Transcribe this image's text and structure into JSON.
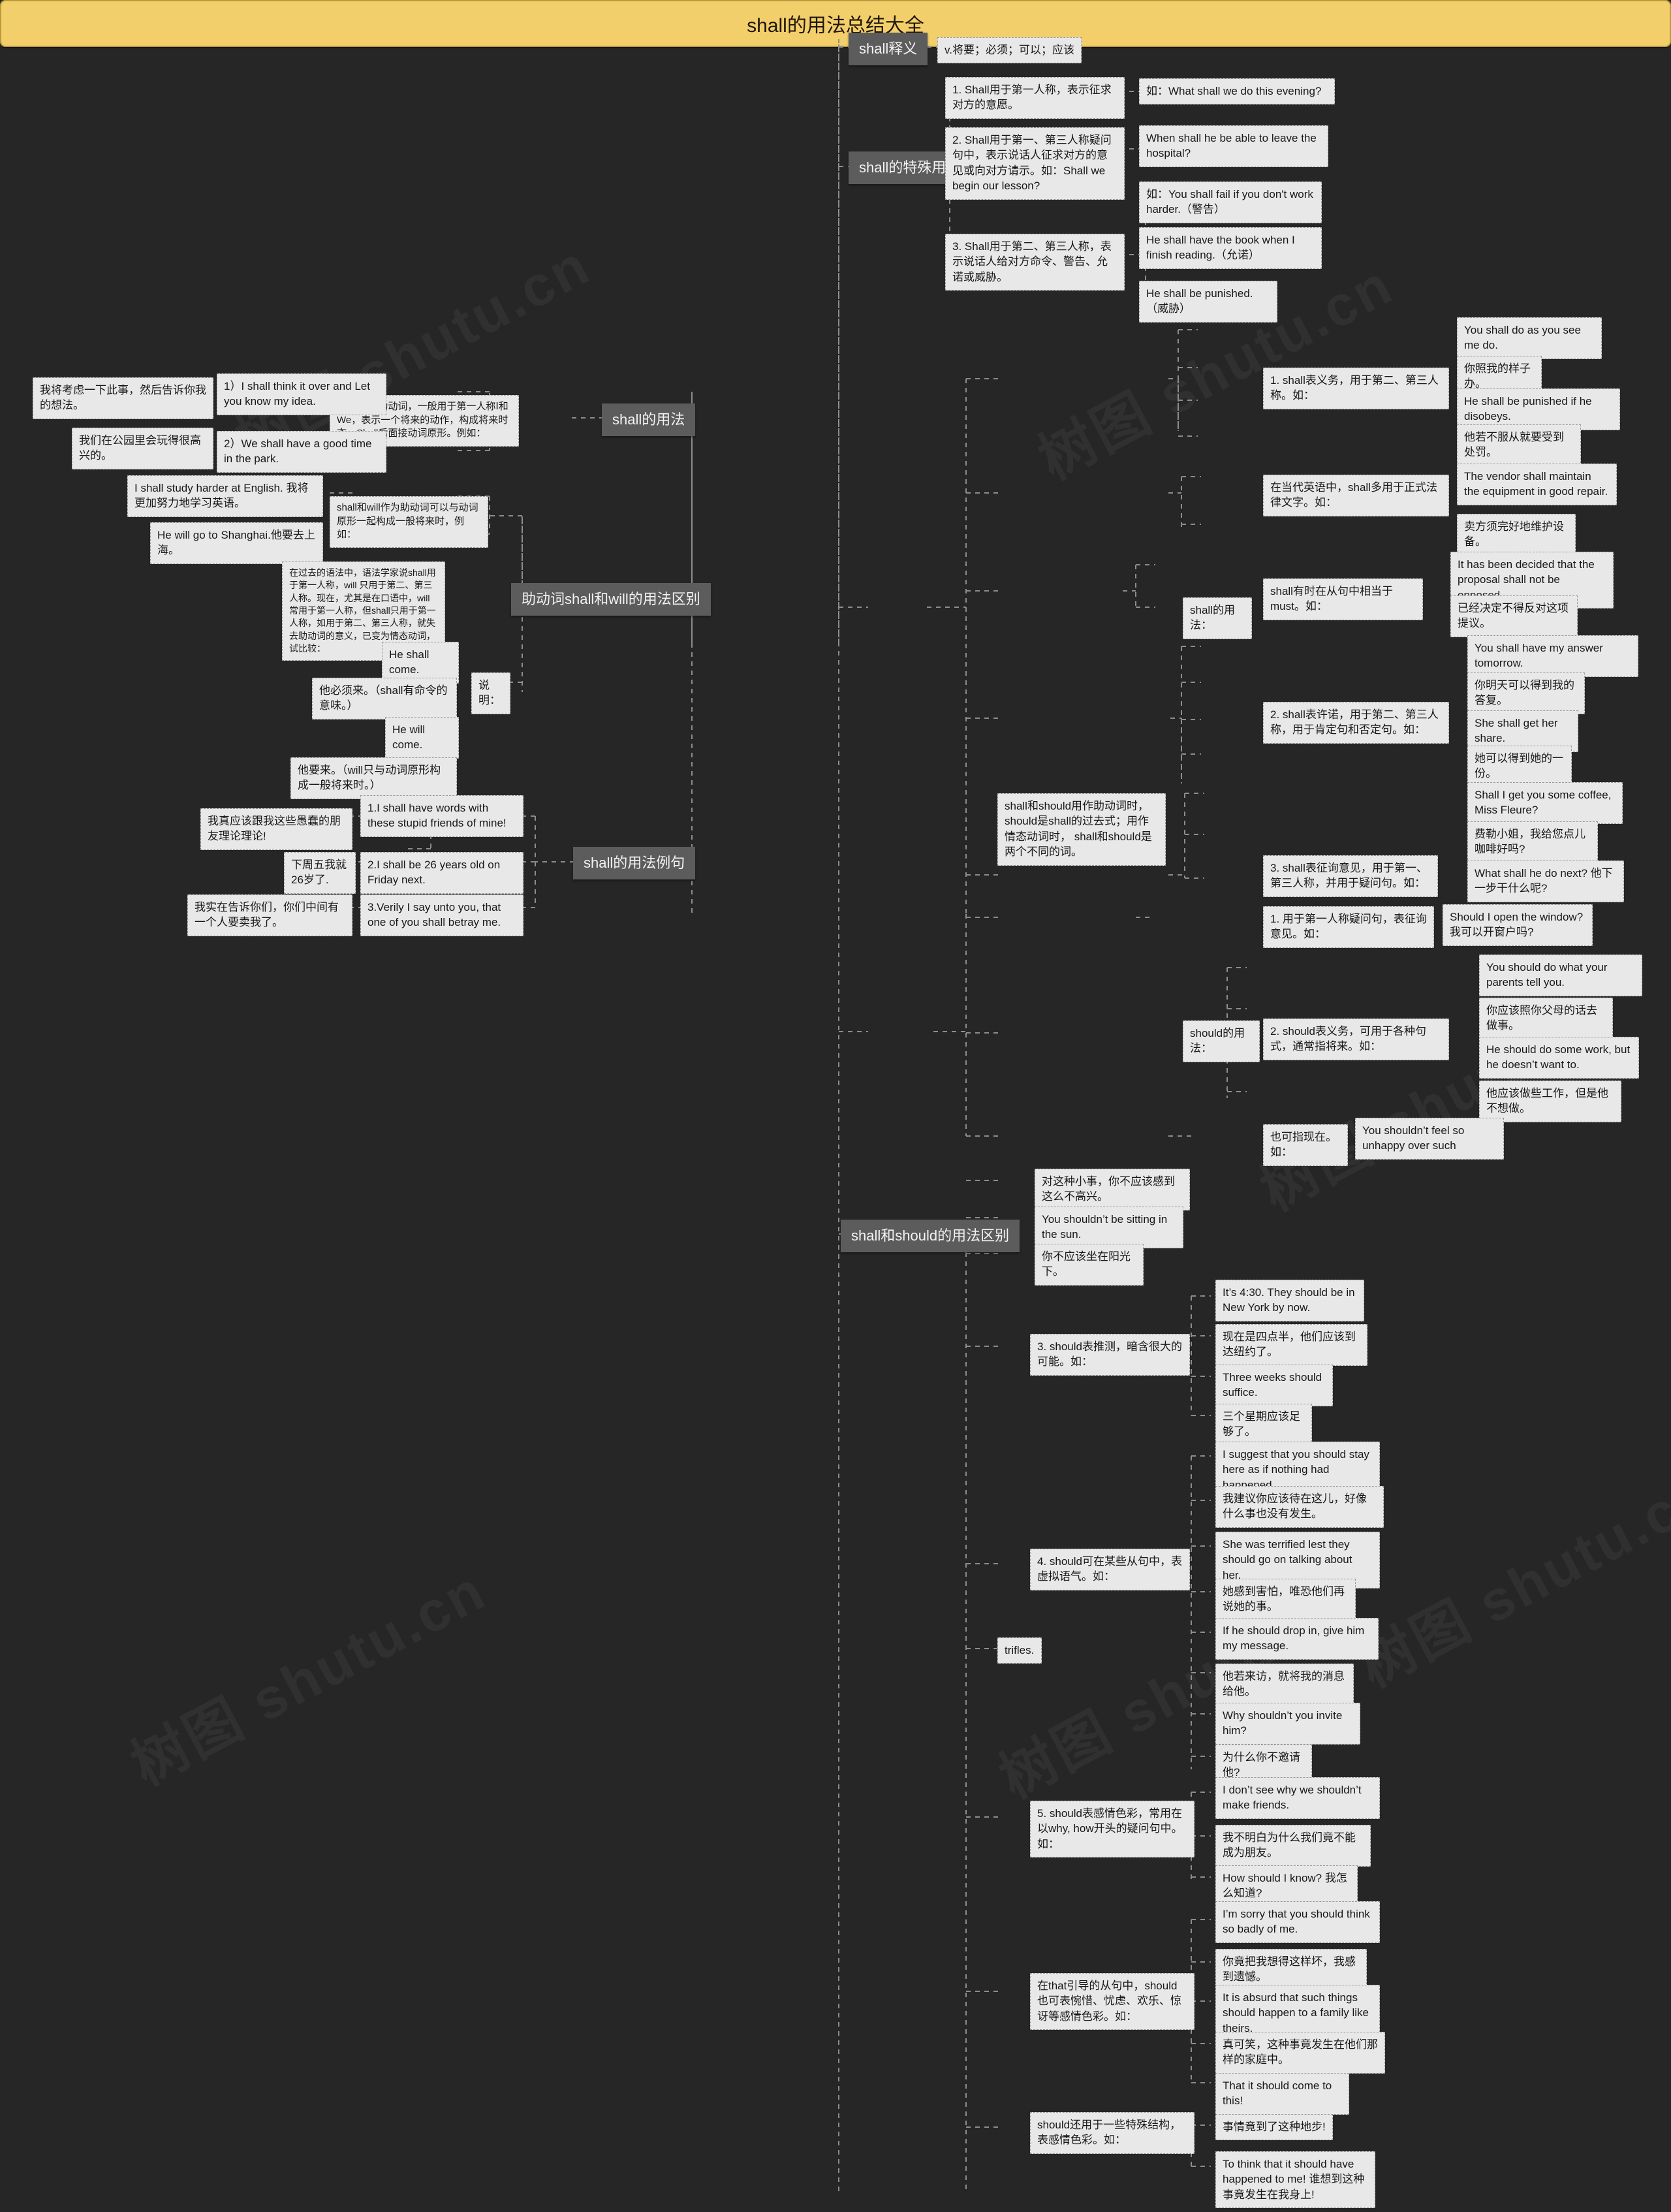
{
  "root": {
    "label": "shall的用法总结大全"
  },
  "watermarks": [
    "树图 shutu.cn",
    "树图 shutu.cn",
    "树图 shutu.cn",
    "树图 shutu.cn",
    "树图 shutu.cn",
    "树图 shutu.cn"
  ],
  "branches": {
    "shall_usage": {
      "label": "shall的用法",
      "intro": "Shall作为助动词，一般用于第一人称Ⅰ和We，表示一个将来的动作，构成将来时态。Shall后面接动词原形。例如：",
      "examples": [
        {
          "en": "1）I shall think it over and Let you know my idea.",
          "zh": "我将考虑一下此事，然后告诉你我的想法。"
        },
        {
          "en": "2）We shall have a good time in the park.",
          "zh": "我们在公园里会玩得很高兴的。"
        }
      ]
    },
    "shall_will": {
      "label": "助动词shall和will的用法区别",
      "intro": "shall和will作为助动词可以与动词原形一起构成一般将来时，例如：",
      "intro_examples": [
        "I shall study harder at English. 我将更加努力地学习英语。",
        "He will go to Shanghai.他要去上海。"
      ],
      "note_label": "说明：",
      "note_text": "在过去的语法中，语法学家说shall用于第一人称，will 只用于第二、第三人称。现在，尤其是在口语中，will常用于第一人称，但shall只用于第一人称，如用于第二、第三人称，就失去助动词的意义，已变为情态动词，试比较：",
      "note_examples": [
        "He shall come.",
        "他必须来。（shall有命令的意味。）",
        "He will come.",
        "他要来。（will只与动词原形构成一般将来时。）"
      ]
    },
    "shall_sentences": {
      "label": "shall的用法例句",
      "items": [
        {
          "en": "1.I shall have words with these stupid friends of mine!",
          "zh": "我真应该跟我这些愚蠢的朋友理论理论!"
        },
        {
          "en": "2.I shall be 26 years old on Friday next.",
          "zh": "下周五我就26岁了."
        },
        {
          "en": "3.Verily I say unto you, that one of you shall betray me.",
          "zh": "我实在告诉你们，你们中间有一个人要卖我了。"
        }
      ]
    },
    "shall_meaning": {
      "label": "shall释义",
      "value": "v.将要；必须；可以；应该"
    },
    "shall_special": {
      "label": "shall的特殊用法",
      "items": [
        {
          "text": "1. Shall用于第一人称，表示征求对方的意愿。",
          "examples": [
            "如：What shall we do this evening?"
          ]
        },
        {
          "text": "2. Shall用于第一、第三人称疑问句中，表示说话人征求对方的意见或向对方请示。如：Shall we begin our lesson?",
          "examples": [
            "When shall he be able to leave the hospital?"
          ]
        },
        {
          "text": "3. Shall用于第二、第三人称，表示说话人给对方命令、警告、允诺或威胁。",
          "examples": [
            "如：You shall fail if you don't work harder.（警告）",
            "He shall have the book when I finish reading.（允诺）",
            "He shall be punished. （威胁）"
          ]
        }
      ]
    },
    "shall_detail": {
      "label": "shall的用法：",
      "items": [
        {
          "text": "1. shall表义务，用于第二、第三人称。如：",
          "examples": [
            "You shall do as you see me do.",
            "你照我的样子办。",
            "He shall be punished if he disobeys.",
            "他若不服从就要受到处罚。"
          ]
        },
        {
          "text": "在当代英语中，shall多用于正式法律文字。如：",
          "examples": [
            "The vendor shall maintain the equipment in good repair.",
            "卖方须完好地维护设备。"
          ]
        },
        {
          "text": "shall有时在从句中相当于must。如：",
          "examples": [
            "It has been decided that the proposal shall not be opposed.",
            "已经决定不得反对这项提议。"
          ]
        },
        {
          "text": "2. shall表许诺，用于第二、第三人称，用于肯定句和否定句。如：",
          "examples": [
            "You shall have my answer tomorrow.",
            "你明天可以得到我的答复。",
            "She shall get her share.",
            "她可以得到她的一份。"
          ]
        },
        {
          "text": "3. shall表征询意见，用于第一、第三人称，并用于疑问句。如：",
          "examples": [
            "Shall I get you some coffee, Miss Fleure?",
            "费勒小姐，我给您点儿咖啡好吗?",
            "What shall he do next? 他下一步干什么呢?"
          ]
        }
      ]
    },
    "should_detail": {
      "label": "should的用法：",
      "items": [
        {
          "text": "1. 用于第一人称疑问句，表征询意见。如：",
          "examples": [
            "Should I open the window? 我可以开窗户吗?"
          ]
        },
        {
          "text": "2. should表义务，可用于各种句式，通常指将来。如：",
          "examples": [
            "You should do what your parents tell you.",
            "你应该照你父母的话去做事。",
            "He should do some work, but he doesn’t want to.",
            "他应该做些工作，但是他不想做。"
          ]
        },
        {
          "text": "也可指现在。如：",
          "examples": [
            "You shouldn’t feel so unhappy over such"
          ]
        }
      ]
    },
    "shall_should_diff": {
      "label": "shall和should的用法区别",
      "intro": "shall和should用作助动词时， should是shall的过去式；用作情态动词时， shall和should是两个不同的词。",
      "loose_nodes": [
        "对这种小事，你不应该感到这么不高兴。",
        "You shouldn’t be sitting in the sun.",
        "你不应该坐在阳光下。",
        "trifles."
      ],
      "items": [
        {
          "text": "3. should表推测，暗含很大的可能。如：",
          "examples": [
            "It’s 4:30. They should be in New York by now.",
            "现在是四点半，他们应该到达纽约了。",
            "Three weeks should suffice.",
            "三个星期应该足够了。"
          ]
        },
        {
          "text": "4. should可在某些从句中，表虚拟语气。如：",
          "examples": [
            "I suggest that you should stay here as if nothing had happened.",
            "我建议你应该待在这儿，好像什么事也没有发生。",
            "She was terrified lest they should go on talking about her.",
            "她感到害怕，唯恐他们再说她的事。",
            "If he should drop in, give him my message.",
            "他若来访，就将我的消息给他。",
            "Why shouldn’t you invite him?",
            "为什么你不邀请他?"
          ]
        },
        {
          "text": "5. should表感情色彩，常用在以why, how开头的疑问句中。如：",
          "examples": [
            "I don’t see why we shouldn’t make friends.",
            "我不明白为什么我们竟不能成为朋友。",
            "How should I know? 我怎么知道?"
          ]
        },
        {
          "text": "在that引导的从句中，should也可表惋惜、忧虑、欢乐、惊讶等感情色彩。如：",
          "examples": [
            "I’m sorry that you should think so badly of me.",
            "你竟把我想得这样坏，我感到遗憾。",
            "It is absurd that such things should happen to a family like theirs.",
            "真可笑，这种事竟发生在他们那样的家庭中。",
            "That it should come to this!"
          ]
        },
        {
          "text": "should还用于一些特殊结构，表感情色彩。如：",
          "examples": [
            "事情竟到了这种地步!",
            "To think that it should have happened to me! 谁想到这种事竟发生在我身上!"
          ]
        }
      ]
    }
  }
}
